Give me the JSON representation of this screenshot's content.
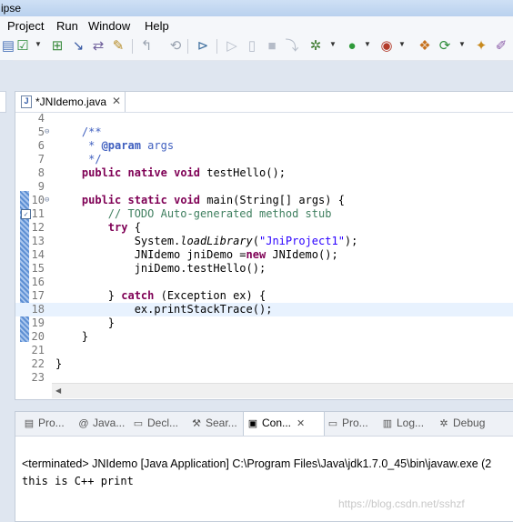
{
  "window": {
    "title": "ipse"
  },
  "menu": [
    "Project",
    "Run",
    "Window",
    "Help"
  ],
  "toolbar_icons": [
    "save-all-icon",
    "checkbox-icon",
    "new-java-icon",
    "refactor-icon",
    "wand-icon",
    "back-icon",
    "sync-icon",
    "terminal-icon",
    "resume-icon",
    "suspend-icon",
    "stop-icon",
    "step-icon",
    "debug-icon",
    "run-icon",
    "coverage-icon",
    "build-icon",
    "refresh-icon",
    "new-package-icon",
    "perspective-icon"
  ],
  "editor": {
    "tab_label": "*JNIdemo.java",
    "lines": [
      {
        "n": "4",
        "segs": []
      },
      {
        "n": "5",
        "fold": "⊖",
        "segs": [
          {
            "t": "    /**",
            "c": "jd"
          }
        ]
      },
      {
        "n": "6",
        "segs": [
          {
            "t": "     * ",
            "c": "jd"
          },
          {
            "t": "@param",
            "c": "jd b"
          },
          {
            "t": " args",
            "c": "jd"
          }
        ]
      },
      {
        "n": "7",
        "segs": [
          {
            "t": "     */",
            "c": "jd"
          }
        ]
      },
      {
        "n": "8",
        "segs": [
          {
            "t": "    ",
            "c": ""
          },
          {
            "t": "public",
            "c": "kw"
          },
          {
            "t": " ",
            "c": ""
          },
          {
            "t": "native",
            "c": "kw"
          },
          {
            "t": " ",
            "c": ""
          },
          {
            "t": "void",
            "c": "kw"
          },
          {
            "t": " testHello();",
            "c": ""
          }
        ]
      },
      {
        "n": "9",
        "segs": []
      },
      {
        "n": "10",
        "fold": "⊖",
        "segs": [
          {
            "t": "    ",
            "c": ""
          },
          {
            "t": "public",
            "c": "kw"
          },
          {
            "t": " ",
            "c": ""
          },
          {
            "t": "static",
            "c": "kw"
          },
          {
            "t": " ",
            "c": ""
          },
          {
            "t": "void",
            "c": "kw"
          },
          {
            "t": " main(String[] args) {",
            "c": ""
          }
        ]
      },
      {
        "n": "11",
        "task": true,
        "segs": [
          {
            "t": "        // TODO Auto-generated method stub",
            "c": "cm"
          }
        ]
      },
      {
        "n": "12",
        "segs": [
          {
            "t": "        ",
            "c": ""
          },
          {
            "t": "try",
            "c": "kw"
          },
          {
            "t": " {",
            "c": ""
          }
        ]
      },
      {
        "n": "13",
        "segs": [
          {
            "t": "            System.",
            "c": ""
          },
          {
            "t": "loadLibrary",
            "c": "it"
          },
          {
            "t": "(",
            "c": ""
          },
          {
            "t": "\"JniProject1\"",
            "c": "st"
          },
          {
            "t": ");",
            "c": ""
          }
        ]
      },
      {
        "n": "14",
        "segs": [
          {
            "t": "            JNIdemo jniDemo =",
            "c": ""
          },
          {
            "t": "new",
            "c": "kw"
          },
          {
            "t": " JNIdemo();",
            "c": ""
          }
        ]
      },
      {
        "n": "15",
        "segs": [
          {
            "t": "            jniDemo.testHello();",
            "c": ""
          }
        ]
      },
      {
        "n": "16",
        "segs": []
      },
      {
        "n": "17",
        "segs": [
          {
            "t": "        } ",
            "c": ""
          },
          {
            "t": "catch",
            "c": "kw"
          },
          {
            "t": " (Exception ex) {",
            "c": ""
          }
        ]
      },
      {
        "n": "18",
        "hl": true,
        "segs": [
          {
            "t": "            ex.printStackTrace();",
            "c": ""
          }
        ]
      },
      {
        "n": "19",
        "segs": [
          {
            "t": "        }",
            "c": ""
          }
        ]
      },
      {
        "n": "20",
        "segs": [
          {
            "t": "    }",
            "c": ""
          }
        ]
      },
      {
        "n": "21",
        "segs": []
      },
      {
        "n": "22",
        "segs": [
          {
            "t": "}",
            "c": ""
          }
        ]
      },
      {
        "n": "23",
        "segs": []
      }
    ]
  },
  "bottom_tabs": [
    {
      "label": "Pro...",
      "icon": "problems-icon",
      "glyph": "▤"
    },
    {
      "label": "Java...",
      "icon": "javadoc-icon",
      "glyph": "@"
    },
    {
      "label": "Decl...",
      "icon": "declaration-icon",
      "glyph": "▭"
    },
    {
      "label": "Sear...",
      "icon": "search-icon",
      "glyph": "⚒"
    },
    {
      "label": "Con...",
      "icon": "console-icon",
      "glyph": "▣",
      "active": true
    },
    {
      "label": "Pro...",
      "icon": "progress-icon",
      "glyph": "▭"
    },
    {
      "label": "Log...",
      "icon": "log-icon",
      "glyph": "▥"
    },
    {
      "label": "Debug",
      "icon": "debug-icon",
      "glyph": "✲"
    }
  ],
  "console": {
    "header": "<terminated> JNIdemo [Java Application] C:\\Program Files\\Java\\jdk1.7.0_45\\bin\\javaw.exe (2",
    "output": "this is C++ print"
  },
  "watermark": "https://blog.csdn.net/sshzf"
}
